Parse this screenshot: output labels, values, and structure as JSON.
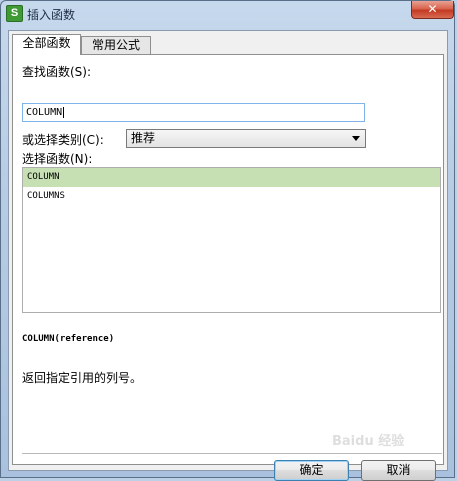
{
  "window": {
    "title": "插入函数",
    "app_icon_letter": "S",
    "close_glyph": "✕"
  },
  "tabs": [
    {
      "label": "全部函数",
      "active": true
    },
    {
      "label": "常用公式",
      "active": false
    }
  ],
  "search": {
    "label": "查找函数(S):",
    "value": "COLUMN"
  },
  "category": {
    "label": "或选择类别(C):",
    "selected": "推荐"
  },
  "functions": {
    "label": "选择函数(N):",
    "items": [
      {
        "name": "COLUMN",
        "selected": true
      },
      {
        "name": "COLUMNS",
        "selected": false
      }
    ]
  },
  "detail": {
    "signature": "COLUMN(reference)",
    "description": "返回指定引用的列号。"
  },
  "buttons": {
    "ok": "确定",
    "cancel": "取消"
  },
  "watermark": "Baidu 经验",
  "colors": {
    "selection": "#c6e0b4",
    "close_button": "#c43a22",
    "input_focus_border": "#7eb4ea"
  }
}
